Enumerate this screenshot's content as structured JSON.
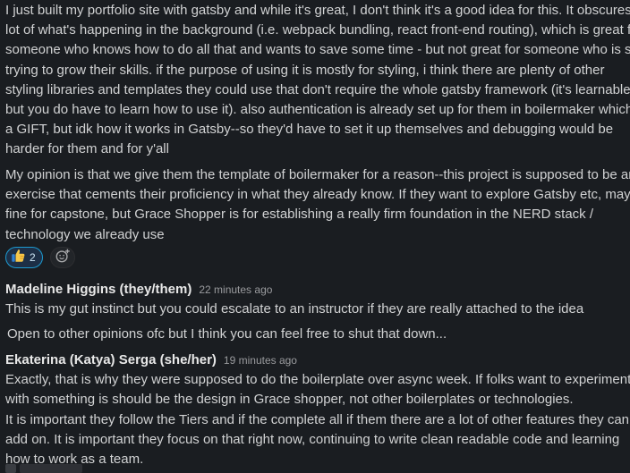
{
  "messages": [
    {
      "text": "I just built my portfolio site with gatsby and while it's great, I don't think it's a good idea for this. It obscures a\nlot of what's happening in the background (i.e. webpack bundling, react front-end routing), which is great for\nsomeone who knows how to do all that and wants to save some time - but not great for someone who is still\ntrying to grow their skills. if the purpose of using it is mostly for styling, i think there are plenty of other\nstyling libraries and templates they could use that don't require the whole gatsby framework (it's learnable,\nbut you do have to learn how to use it). also authentication is already set up for them in boilermaker which is\na GIFT, but idk how it works in Gatsby--so they'd have to set it up themselves and debugging would be\nharder for them and for y'all"
    },
    {
      "text": "My opinion is that we give them the template of boilermaker for a reason--this project is supposed to be an\nexercise that cements their proficiency in what they already know. If they want to explore Gatsby etc, maybe\nfine for capstone, but Grace Shopper is for establishing a really firm foundation in the NERD stack /\ntechnology we already use",
      "reaction": {
        "emoji": "thumbs-up",
        "count": "2"
      }
    },
    {
      "author": "Madeline Higgins (they/them)",
      "time": "22 minutes ago",
      "lines": [
        "This is my gut instinct but you could escalate to an instructor if they are really attached to the idea",
        "Open to other opinions ofc but I think you can feel free to shut that down..."
      ]
    },
    {
      "author": "Ekaterina (Katya) Serga (she/her)",
      "time": "19 minutes ago",
      "text1": "Exactly, that is why they were supposed to do the boilerplate over async week. If folks want to experiment\nwith something is should be the design in Grace shopper, not other boilerplates or technologies.",
      "text2": "It is important they follow the Tiers and if the complete all if them there are a lot of other features they can\nadd on. It is important they focus on that right now, continuing to write clean readable code and learning\nhow to work as a team."
    }
  ],
  "icons": {
    "reaction": "thumbs-up-emoji",
    "add_reaction": "add-reaction-icon"
  },
  "colors": {
    "background": "#1a1d21",
    "text": "#d1d2d3",
    "reaction_border": "#1d9bd1",
    "reaction_bg": "#1d2f46"
  }
}
